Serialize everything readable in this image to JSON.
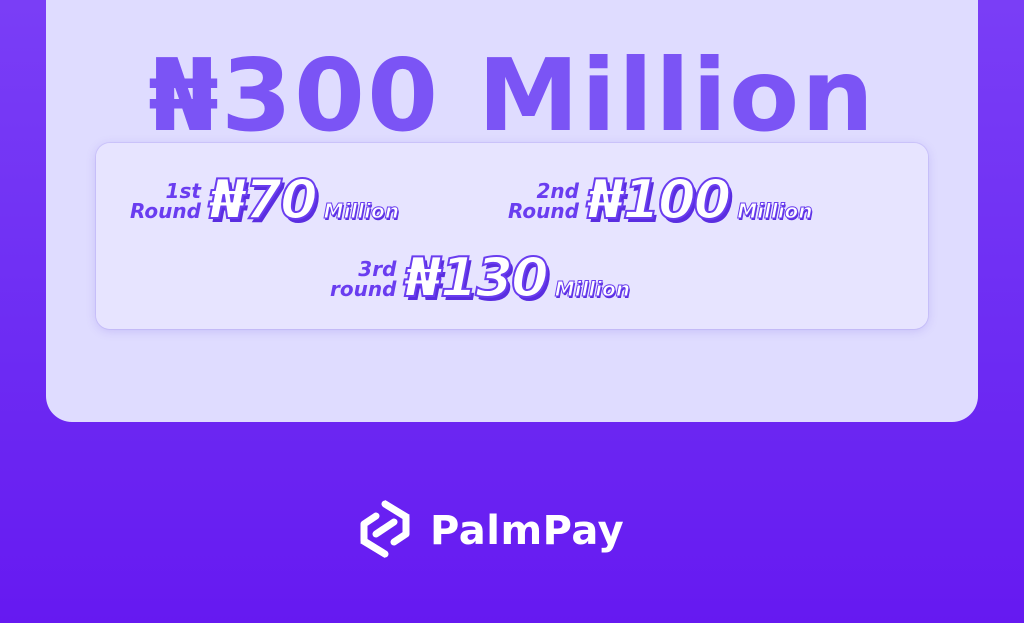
{
  "banner": {
    "headline": "₦300 Million"
  },
  "rounds": [
    {
      "label_line1": "1st",
      "label_line2": "Round",
      "amount": "₦70",
      "unit": "Million"
    },
    {
      "label_line1": "2nd",
      "label_line2": "Round",
      "amount": "₦100",
      "unit": "Million"
    },
    {
      "label_line1": "3rd",
      "label_line2": "round",
      "amount": "₦130",
      "unit": "Million"
    }
  ],
  "brand": {
    "logo_icon": "palmpay-logo-icon",
    "name": "PalmPay"
  },
  "colors": {
    "background": "#6d2cf3",
    "card": "#dfdcff",
    "accent": "#6a3df0"
  }
}
